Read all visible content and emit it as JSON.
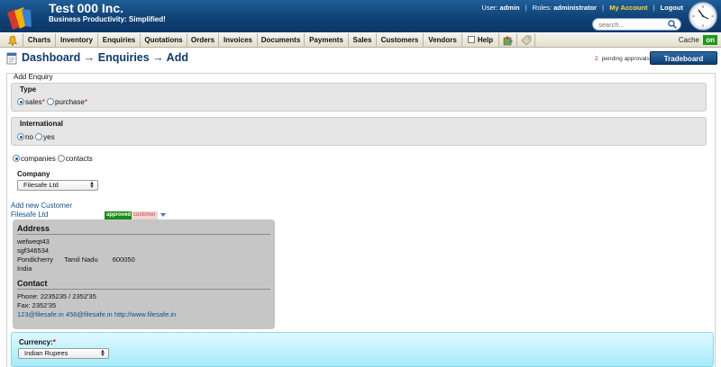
{
  "header": {
    "company": "Test 000 Inc.",
    "tagline": "Business Productivity: Simplified!",
    "user_label": "User:",
    "user": "admin",
    "roles_label": "Roles:",
    "roles": "administrator",
    "my_account": "My Account",
    "logout": "Logout",
    "search_placeholder": "search..."
  },
  "nav": {
    "items": [
      "Charts",
      "Inventory",
      "Enquiries",
      "Quotations",
      "Orders",
      "Invoices",
      "Documents",
      "Payments",
      "Sales",
      "Customers",
      "Vendors",
      "Help"
    ],
    "cache_label": "Cache",
    "cache_state": "on"
  },
  "title": {
    "text": "Dashboard → Enquiries → Add",
    "pending_count": "2",
    "pending_label": "pending approvals",
    "tradeboard": "Tradeboard"
  },
  "form": {
    "legend": "Add Enquiry",
    "type": {
      "label": "Type",
      "options": [
        "sales",
        "purchase"
      ],
      "selected": "sales"
    },
    "international": {
      "label": "International",
      "options": [
        "no",
        "yes"
      ],
      "selected": "no"
    },
    "party": {
      "options": [
        "companies",
        "contacts"
      ],
      "selected": "companies"
    },
    "company": {
      "label": "Company",
      "value": "Filesafe Ltd"
    },
    "add_new_customer": "Add new Customer",
    "customer_name": "Filesafe Ltd",
    "badges": {
      "approved": "approved",
      "customer": "customer"
    },
    "address": {
      "heading": "Address",
      "line1": "wefweqt43",
      "line2": "sgf346534",
      "city": "Pondicherry",
      "state": "Tamil Nadu",
      "zip": "600050",
      "country": "India"
    },
    "contact": {
      "heading": "Contact",
      "phone": "Phone: 2235235 / 2352'35",
      "fax": "Fax: 2352'35",
      "email1": "123@filesafe.in",
      "email2": "456@filesafe.in",
      "website": "http://www.filesafe.in"
    },
    "currency": {
      "label": "Currency:",
      "value": "Indian Rupees"
    }
  },
  "colors": {
    "header_bg": "#0f3f72",
    "title": "#0f3a6b",
    "highlight": "#ffd83a",
    "approved": "#1a8a1a",
    "currency_bg": "#a6ecfa"
  },
  "icons": [
    "logo-icon",
    "search-icon",
    "clock-icon",
    "bell-icon",
    "puzzle-icon",
    "tag-icon",
    "document-icon"
  ]
}
